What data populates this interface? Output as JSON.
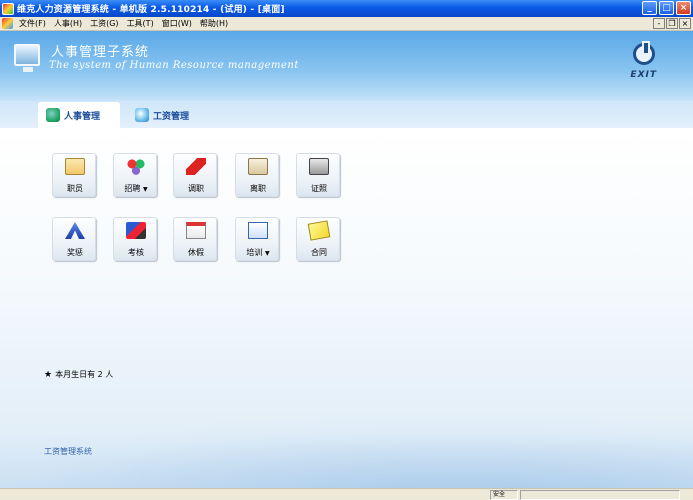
{
  "window": {
    "title": "维克人力资源管理系统 - 单机版 2.5.110214 - (试用) - [桌面]",
    "buttons": {
      "minimize": "_",
      "maximize": "□",
      "close": "×"
    }
  },
  "menubar": {
    "items": [
      "文件(F)",
      "人事(H)",
      "工资(G)",
      "工具(T)",
      "窗口(W)",
      "帮助(H)"
    ],
    "mdi_buttons": {
      "minimize": "-",
      "restore": "❐",
      "close": "×"
    }
  },
  "banner": {
    "title": "人事管理子系统",
    "subtitle": "The system of Human Resource management",
    "exit_label": "EXIT"
  },
  "tabs": [
    {
      "label": "人事管理",
      "active": true
    },
    {
      "label": "工资管理",
      "active": false
    }
  ],
  "tiles": {
    "row1": [
      {
        "label": "职员",
        "icon": "id-card-icon",
        "dropdown": false
      },
      {
        "label": "招聘",
        "icon": "recruit-icon",
        "dropdown": true
      },
      {
        "label": "调职",
        "icon": "transfer-arrow-icon",
        "dropdown": false
      },
      {
        "label": "离职",
        "icon": "leave-icon",
        "dropdown": false
      },
      {
        "label": "证照",
        "icon": "certificate-icon",
        "dropdown": false
      }
    ],
    "row2": [
      {
        "label": "奖惩",
        "icon": "reward-icon",
        "dropdown": false
      },
      {
        "label": "考核",
        "icon": "assessment-icon",
        "dropdown": false
      },
      {
        "label": "休假",
        "icon": "calendar-icon",
        "dropdown": false
      },
      {
        "label": "培训",
        "icon": "training-icon",
        "dropdown": true
      },
      {
        "label": "合同",
        "icon": "contract-icon",
        "dropdown": false
      }
    ]
  },
  "birthday_notice": "本月生日有 2 人",
  "birthday_star": "★",
  "footer_link": "工资管理系统",
  "statusbar": {
    "cell1": "安全",
    "cell2": ""
  }
}
